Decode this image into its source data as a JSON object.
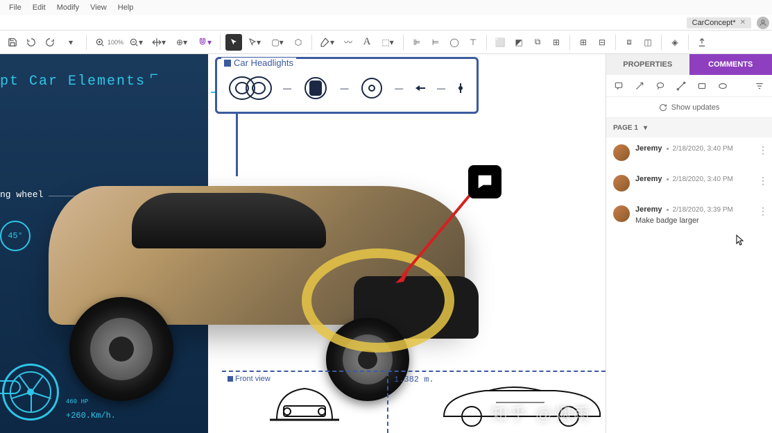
{
  "menu": {
    "file": "File",
    "edit": "Edit",
    "modify": "Modify",
    "view": "View",
    "help": "Help"
  },
  "doc": {
    "name": "CarConcept*"
  },
  "zoom": "100%",
  "toolbar": {
    "groups": [
      [
        "save",
        "undo",
        "redo",
        "d"
      ],
      [
        "zoom-fit",
        "zoom-out",
        "pan",
        "ruler",
        "magnet"
      ],
      [
        "pointer",
        "direct",
        "d",
        "node"
      ],
      [
        "pen",
        "brush",
        "text",
        "frame"
      ],
      [
        "align-l",
        "align-c",
        "align-r",
        "align-t"
      ],
      [
        "boolean-u",
        "boolean-s",
        "boolean-i",
        "flip"
      ],
      [
        "group",
        "ungroup"
      ],
      [
        "crop",
        "mask"
      ],
      [
        "component"
      ],
      [
        "export"
      ]
    ]
  },
  "canvas": {
    "title": "pt Car Elements",
    "steering_label": "ng wheel",
    "fortyfive": "45°",
    "hp": "460 HP",
    "speed": "+260.Km/h.",
    "headlights_label": "Car Headlights",
    "front_view_label": "Front view",
    "dimension": "1.382 m."
  },
  "side": {
    "tab_prop": "PROPERTIES",
    "tab_comm": "COMMENTS",
    "show_updates": "Show updates",
    "page": "PAGE 1",
    "comments": [
      {
        "author": "Jeremy",
        "time": "2/18/2020, 3:40 PM",
        "text": ""
      },
      {
        "author": "Jeremy",
        "time": "2/18/2020, 3:40 PM",
        "text": ""
      },
      {
        "author": "Jeremy",
        "time": "2/18/2020, 3:39 PM",
        "text": "Make badge larger"
      }
    ]
  },
  "watermark": "知乎 @烟雨"
}
